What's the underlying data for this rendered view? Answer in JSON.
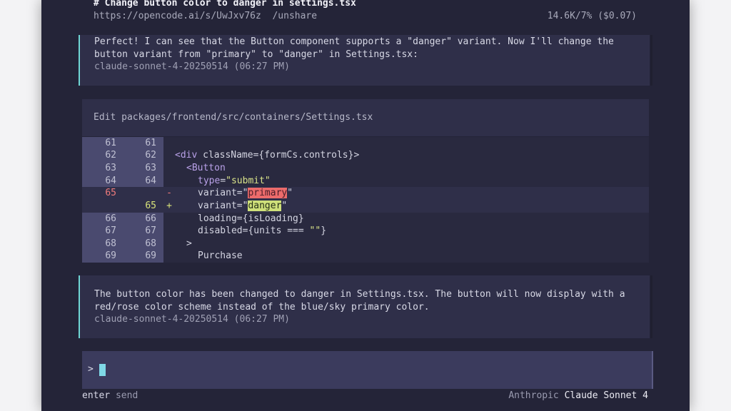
{
  "header": {
    "title": "# Change button color to danger in settings.tsx",
    "share_url": "https://opencode.ai/s/UwJxv76z",
    "unshare": "/unshare",
    "stats": "14.6K/7% ($0.07)"
  },
  "messages": [
    {
      "text": "Perfect! I can see that the Button component supports a \"danger\" variant. Now I'll change the button variant from \"primary\" to \"danger\" in Settings.tsx:",
      "meta": "claude-sonnet-4-20250514 (06:27 PM)"
    },
    {
      "text": "The button color has been changed to danger in Settings.tsx. The button will now display with a red/rose color scheme instead of the blue/sky primary color.",
      "meta": "claude-sonnet-4-20250514 (06:27 PM)"
    }
  ],
  "edit": {
    "header": "Edit packages/frontend/src/containers/Settings.tsx",
    "lines": {
      "l61": {
        "old": "61",
        "new": "61"
      },
      "l62": {
        "old": "62",
        "new": "62",
        "p1": "<div",
        "p2": " className={formCs.controls}>"
      },
      "l63": {
        "old": "63",
        "new": "63",
        "p1": "<Button"
      },
      "l64": {
        "old": "64",
        "new": "64",
        "p1": "type",
        "p2": "=",
        "p3": "\"submit\""
      },
      "del": {
        "old": "65",
        "sign": "-",
        "p1": "variant=\"",
        "p2": "primary",
        "p3": "\""
      },
      "add": {
        "new": "65",
        "sign": "+",
        "p1": "variant=\"",
        "p2": "danger",
        "p3": "\""
      },
      "l66": {
        "old": "66",
        "new": "66",
        "p1": "loading={isLoading}"
      },
      "l67": {
        "old": "67",
        "new": "67",
        "p1": "disabled={units === ",
        "p2": "\"\"",
        "p3": "}"
      },
      "l68": {
        "old": "68",
        "new": "68",
        "p1": ">"
      },
      "l69": {
        "old": "69",
        "new": "69",
        "p1": "Purchase"
      }
    }
  },
  "input": {
    "prompt": ">"
  },
  "footer": {
    "key": "enter",
    "action": " send",
    "provider": "Anthropic ",
    "model": "Claude Sonnet 4"
  },
  "colors": {
    "background": "#242438",
    "panel": "#2f2f49",
    "accent": "#6fd6d4",
    "deletion": "#ec6b6b",
    "addition": "#cfe07a",
    "cursor": "#7fd8e6"
  }
}
